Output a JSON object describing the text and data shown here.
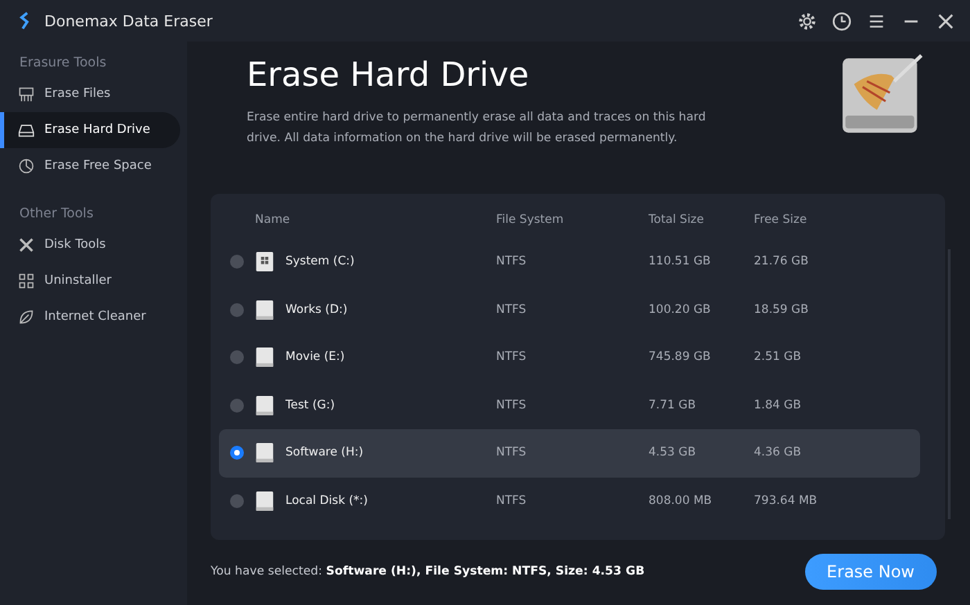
{
  "window": {
    "title": "Donemax Data Eraser"
  },
  "sidebar": {
    "sections": [
      {
        "heading": "Erasure Tools",
        "items": [
          {
            "label": "Erase Files",
            "selected": false
          },
          {
            "label": "Erase Hard Drive",
            "selected": true
          },
          {
            "label": "Erase Free Space",
            "selected": false
          }
        ]
      },
      {
        "heading": "Other Tools",
        "items": [
          {
            "label": "Disk Tools",
            "selected": false
          },
          {
            "label": "Uninstaller",
            "selected": false
          },
          {
            "label": "Internet Cleaner",
            "selected": false
          }
        ]
      }
    ]
  },
  "page": {
    "title": "Erase Hard Drive",
    "description": "Erase entire hard drive to permanently erase all data and traces on this hard drive. All data information on the hard drive will be erased permanently."
  },
  "table": {
    "columns": [
      "Name",
      "File System",
      "Total Size",
      "Free Size"
    ],
    "rows": [
      {
        "kind": "system",
        "name": "System (C:)",
        "file_system": "NTFS",
        "total": "110.51 GB",
        "free": "21.76 GB",
        "selected": false
      },
      {
        "kind": "disk",
        "name": "Works (D:)",
        "file_system": "NTFS",
        "total": "100.20 GB",
        "free": "18.59 GB",
        "selected": false
      },
      {
        "kind": "disk",
        "name": "Movie (E:)",
        "file_system": "NTFS",
        "total": "745.89 GB",
        "free": "2.51 GB",
        "selected": false
      },
      {
        "kind": "disk",
        "name": "Test (G:)",
        "file_system": "NTFS",
        "total": "7.71 GB",
        "free": "1.84 GB",
        "selected": false
      },
      {
        "kind": "disk",
        "name": "Software (H:)",
        "file_system": "NTFS",
        "total": "4.53 GB",
        "free": "4.36 GB",
        "selected": true
      },
      {
        "kind": "disk",
        "name": "Local Disk (*:)",
        "file_system": "NTFS",
        "total": "808.00 MB",
        "free": "793.64 MB",
        "selected": false
      }
    ]
  },
  "footer": {
    "selection_text": "You have selected: **Software (H:), File System: NTFS, Size: 4.53 GB**",
    "button": "Erase Now"
  }
}
